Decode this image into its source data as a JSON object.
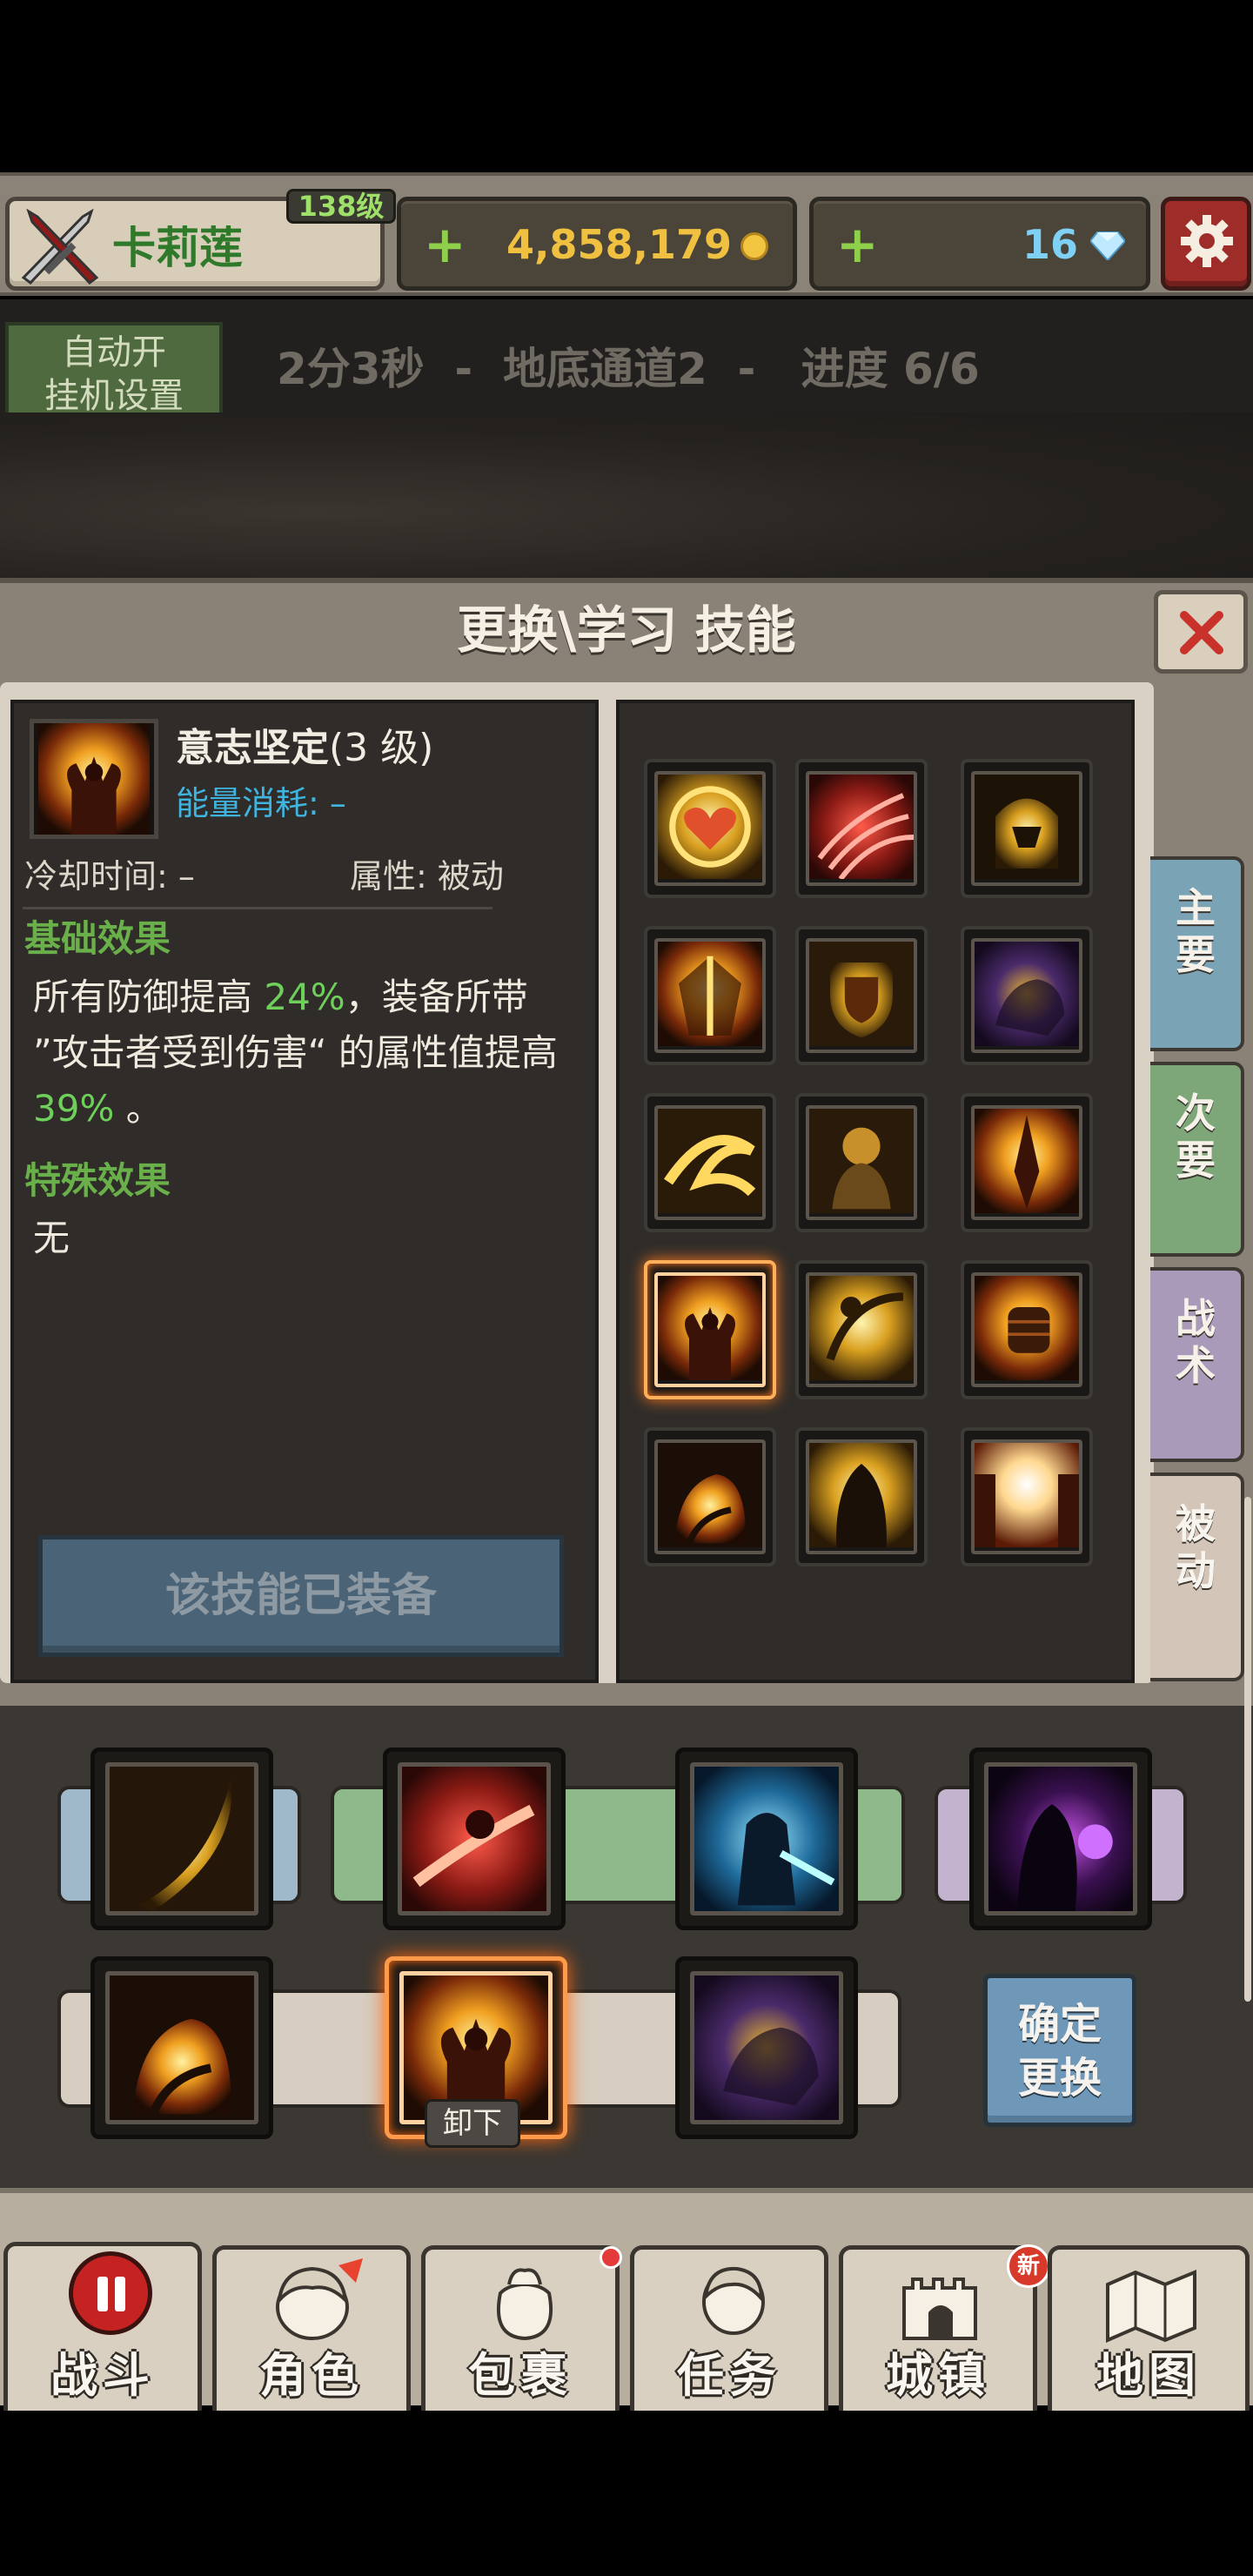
{
  "player": {
    "name": "卡莉莲",
    "level": "138级"
  },
  "currency": {
    "gold": "4,858,179",
    "gems": "16",
    "add_symbol": "+"
  },
  "auto": {
    "button_line1": "自动开",
    "button_line2": "挂机设置",
    "status": "2分3秒  -  地底通道2  -   进度 6/6"
  },
  "dialog": {
    "title": "更换\\学习 技能",
    "close_icon": "close-x-icon",
    "detail": {
      "name": "意志坚定",
      "level_suffix": "(3 级)",
      "energy": "能量消耗: –",
      "cooldown": "冷却时间: –",
      "attribute": "属性: 被动",
      "base_title": "基础效果",
      "base_text_1": "所有防御提高 ",
      "base_pct_1": "24%",
      "base_text_2": "，装备所带 ”攻击者受到伤害“ 的属性值提高 ",
      "base_pct_2": "39%",
      "base_text_3": " 。",
      "special_title": "特殊效果",
      "special_text": "无",
      "equipped_button": "该技能已装备"
    },
    "tabs": [
      "主要",
      "次要",
      "战术",
      "被动"
    ],
    "skill_grid_icons": [
      "golden-heart-icon",
      "red-claw-icon",
      "golden-helm-icon",
      "golden-shield-icon",
      "shield-guard-icon",
      "dark-beast-icon",
      "golden-spiral-icon",
      "armored-warrior-icon",
      "golden-blade-icon",
      "will-steadfast-icon",
      "spinning-strike-icon",
      "golden-fist-icon",
      "flaming-gauntlet-icon",
      "hooded-figure-icon",
      "radiant-gate-icon"
    ],
    "selected_index": 9
  },
  "loadout": {
    "row1_icons": [
      "curved-blade-icon",
      "fire-dash-icon",
      "ice-warrior-icon",
      "shadow-mage-icon"
    ],
    "row2_icons": [
      "flaming-gauntlet-icon",
      "will-steadfast-icon",
      "dark-beast-icon"
    ],
    "unequip_label": "卸下",
    "confirm_label_1": "确定",
    "confirm_label_2": "更换"
  },
  "nav": {
    "items": [
      "战斗",
      "角色",
      "包裹",
      "任务",
      "城镇",
      "地图"
    ],
    "new_badge": "新"
  },
  "colors": {
    "accent_green": "#6ed05a",
    "energy_blue": "#3fb4de",
    "gold": "#f0c040",
    "tab_main": "#7aa3b6",
    "tab_secondary": "#7ea779",
    "tab_tactic": "#a99ab9",
    "tab_passive": "#d3c6b8"
  }
}
